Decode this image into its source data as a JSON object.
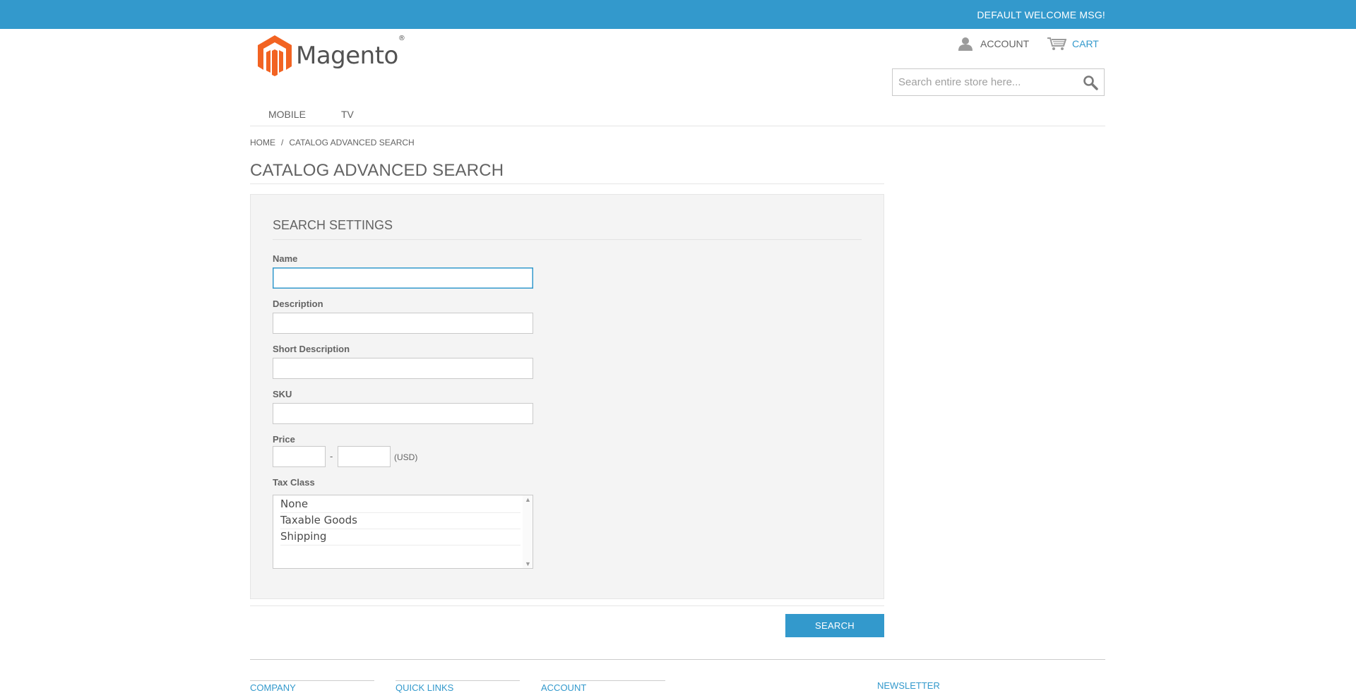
{
  "topbar": {
    "welcome": "DEFAULT WELCOME MSG!",
    "color": "#3399cc"
  },
  "header": {
    "logo_text": "Magento",
    "logo_mark": "®",
    "account_label": "ACCOUNT",
    "cart_label": "CART",
    "search_placeholder": "Search entire store here..."
  },
  "nav": {
    "items": [
      "MOBILE",
      "TV"
    ]
  },
  "breadcrumb": {
    "home": "HOME",
    "separator": "/",
    "current": "CATALOG ADVANCED SEARCH"
  },
  "page": {
    "title": "CATALOG ADVANCED SEARCH",
    "legend": "SEARCH SETTINGS",
    "fields": {
      "name": {
        "label": "Name",
        "value": ""
      },
      "description": {
        "label": "Description",
        "value": ""
      },
      "short_description": {
        "label": "Short Description",
        "value": ""
      },
      "sku": {
        "label": "SKU",
        "value": ""
      },
      "price": {
        "label": "Price",
        "separator": "-",
        "currency": "(USD)"
      },
      "tax_class": {
        "label": "Tax Class",
        "options": [
          "None",
          "Taxable Goods",
          "Shipping"
        ]
      }
    },
    "search_button": "SEARCH"
  },
  "footer": {
    "columns": [
      "COMPANY",
      "QUICK LINKS",
      "ACCOUNT"
    ],
    "newsletter": "NEWSLETTER"
  }
}
